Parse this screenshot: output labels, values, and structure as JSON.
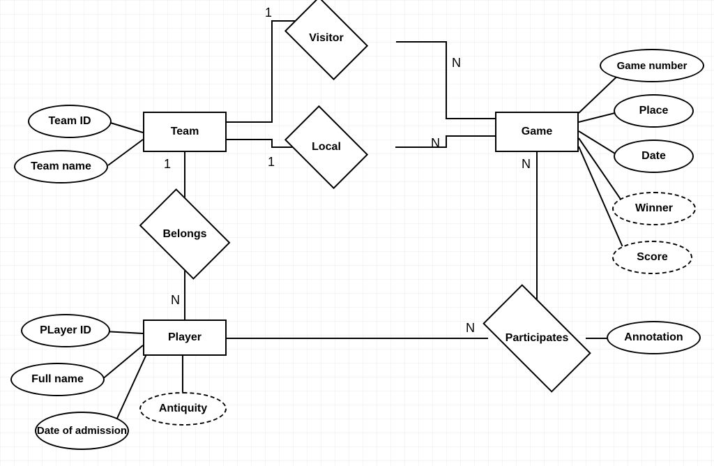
{
  "entities": {
    "team": "Team",
    "game": "Game",
    "player": "Player"
  },
  "relationships": {
    "visitor": "Visitor",
    "local": "Local",
    "belongs": "Belongs",
    "participates": "Participates"
  },
  "attributes": {
    "team_id": "Team ID",
    "team_name": "Team name",
    "player_id": "PLayer ID",
    "full_name": "Full name",
    "date_admission": "Date of admission",
    "antiquity": "Antiquity",
    "game_number": "Game number",
    "place": "Place",
    "date": "Date",
    "winner": "Winner",
    "score": "Score",
    "annotation": "Annotation"
  },
  "cardinalities": {
    "visitor_team": "1",
    "visitor_game": "N",
    "local_team": "1",
    "local_game": "N",
    "belongs_team": "1",
    "belongs_player": "N",
    "participates_game": "N",
    "participates_player": "N"
  }
}
